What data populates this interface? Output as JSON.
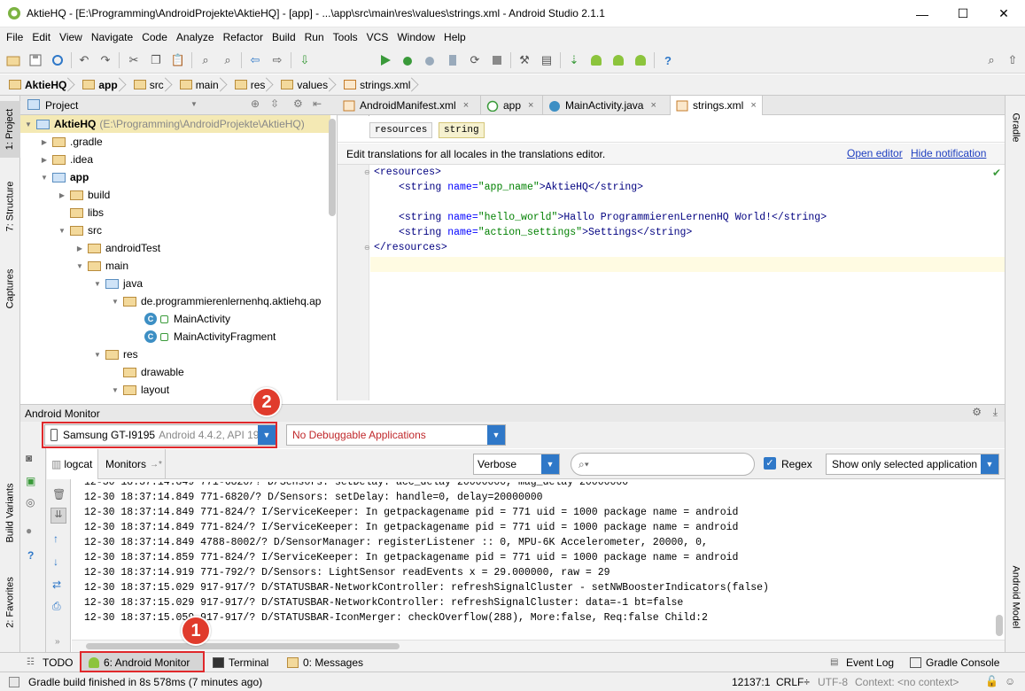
{
  "window": {
    "title": "AktieHQ - [E:\\Programming\\AndroidProjekte\\AktieHQ] - [app] - ...\\app\\src\\main\\res\\values\\strings.xml - Android Studio 2.1.1",
    "minimize": "—",
    "maximize": "☐",
    "close": "✕"
  },
  "menu": [
    "File",
    "Edit",
    "View",
    "Navigate",
    "Code",
    "Analyze",
    "Refactor",
    "Build",
    "Run",
    "Tools",
    "VCS",
    "Window",
    "Help"
  ],
  "toolbar": {
    "run_config": "app"
  },
  "breadcrumbs": [
    "AktieHQ",
    "app",
    "src",
    "main",
    "res",
    "values",
    "strings.xml"
  ],
  "left_strip": {
    "project": "1: Project",
    "structure": "7: Structure",
    "captures": "Captures",
    "build_variants": "Build Variants",
    "favorites": "2: Favorites"
  },
  "right_strip": {
    "gradle": "Gradle",
    "android_model": "Android Model"
  },
  "project_panel": {
    "header": "Project",
    "tree": [
      {
        "label": "AktieHQ",
        "hint": "(E:\\Programming\\AndroidProjekte\\AktieHQ)"
      },
      {
        "label": ".gradle"
      },
      {
        "label": ".idea"
      },
      {
        "label": "app"
      },
      {
        "label": "build"
      },
      {
        "label": "libs"
      },
      {
        "label": "src"
      },
      {
        "label": "androidTest"
      },
      {
        "label": "main"
      },
      {
        "label": "java"
      },
      {
        "label": "de.programmierenlernenhq.aktiehq.ap"
      },
      {
        "label": "MainActivity"
      },
      {
        "label": "MainActivityFragment"
      },
      {
        "label": "res"
      },
      {
        "label": "drawable"
      },
      {
        "label": "layout"
      }
    ]
  },
  "editor": {
    "tabs": [
      "AndroidManifest.xml",
      "app",
      "MainActivity.java",
      "strings.xml"
    ],
    "tab_close": "×",
    "xml_path": [
      "resources",
      "string"
    ],
    "notification": {
      "text": "Edit translations for all locales in the translations editor.",
      "open_editor": "Open editor",
      "hide": "Hide notification"
    },
    "code": {
      "open": "<resources>",
      "s1_open": "<string ",
      "s1_attr": "name=",
      "s1_val": "\"app_name\"",
      "s1_body": ">AktieHQ</string>",
      "s2_val": "\"hello_world\"",
      "s2_body": ">Hallo ProgrammierenLernenHQ World!</string>",
      "s3_val": "\"action_settings\"",
      "s3_body": ">Settings</string>",
      "close": "</resources>"
    }
  },
  "android_monitor": {
    "title": "Android Monitor",
    "device": "Samsung GT-I9195",
    "device_detail": "Android 4.4.2, API 19",
    "app_select": "No Debuggable Applications",
    "tabs": {
      "logcat": "logcat",
      "monitors": "Monitors"
    },
    "log_level": "Verbose",
    "regex_label": "Regex",
    "regex_checked": true,
    "filter": "Show only selected application",
    "log_lines": [
      "12-30 18:37:14.849 771-6820/? D/Sensors: setDelay: handle=0, delay=20000000",
      "12-30 18:37:14.849 771-824/? I/ServiceKeeper: In getpackagename pid = 771 uid = 1000 package name = android",
      "12-30 18:37:14.849 771-824/? I/ServiceKeeper: In getpackagename pid = 771 uid = 1000 package name = android",
      "12-30 18:37:14.849 4788-8002/? D/SensorManager: registerListener :: 0, MPU-6K Accelerometer, 20000, 0,",
      "12-30 18:37:14.859 771-824/? I/ServiceKeeper: In getpackagename pid = 771 uid = 1000 package name = android",
      "12-30 18:37:14.919 771-792/? D/Sensors: LightSensor readEvents x = 29.000000, raw = 29",
      "12-30 18:37:15.029 917-917/? D/STATUSBAR-NetworkController: refreshSignalCluster - setNWBoosterIndicators(false)",
      "12-30 18:37:15.029 917-917/? D/STATUSBAR-NetworkController: refreshSignalCluster: data=-1 bt=false",
      "12-30 18:37:15.059 917-917/? D/STATUSBAR-IconMerger: checkOverflow(288), More:false, Req:false Child:2"
    ]
  },
  "bottom_tabs": {
    "todo": "TODO",
    "android_monitor": "6: Android Monitor",
    "terminal": "Terminal",
    "messages": "0: Messages",
    "event_log": "Event Log",
    "gradle_console": "Gradle Console"
  },
  "status": {
    "message": "Gradle build finished in 8s 578ms (7 minutes ago)",
    "position": "12137:1",
    "line_sep": "CRLF÷",
    "encoding": "UTF-8",
    "context": "Context: <no context>"
  },
  "callouts": [
    "1",
    "2"
  ],
  "colors": {
    "accent": "#2f78c8",
    "callout_red": "#e0282b",
    "xml_tag": "#000080",
    "xml_value": "#008000"
  }
}
